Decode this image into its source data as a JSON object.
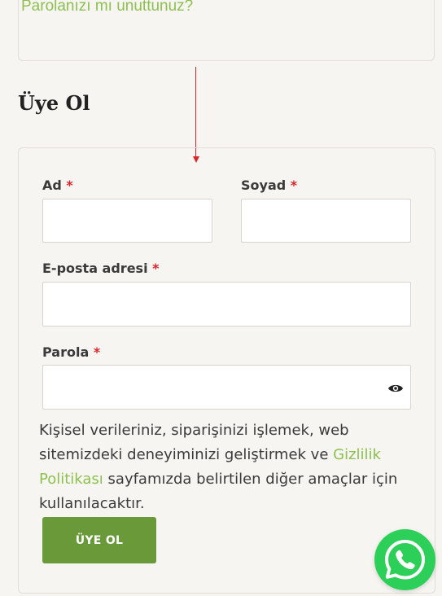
{
  "login": {
    "lost_password": "Parolanızı mı unuttunuz?"
  },
  "register": {
    "title": "Üye Ol",
    "first_name_label": "Ad",
    "last_name_label": "Soyad",
    "email_label": "E-posta adresi",
    "password_label": "Parola",
    "required_mark": "*",
    "privacy_text_before": "Kişisel verileriniz, siparişinizi işlemek, web sitemizdeki deneyiminizi geliştirmek ve ",
    "privacy_link": "Gizlilik Politikası",
    "privacy_text_after": " sayfamızda belirtilen diğer amaçlar için kullanılacaktır.",
    "submit_label": "ÜYE OL"
  },
  "colors": {
    "accent_green": "#8cc04f",
    "button_green": "#6a993a",
    "required_red": "#e0242c",
    "annotation_arrow": "#d9262b",
    "whatsapp_green": "#2ccf57"
  },
  "icons": {
    "password_toggle": "eye-icon",
    "floating_chat": "whatsapp-icon"
  }
}
